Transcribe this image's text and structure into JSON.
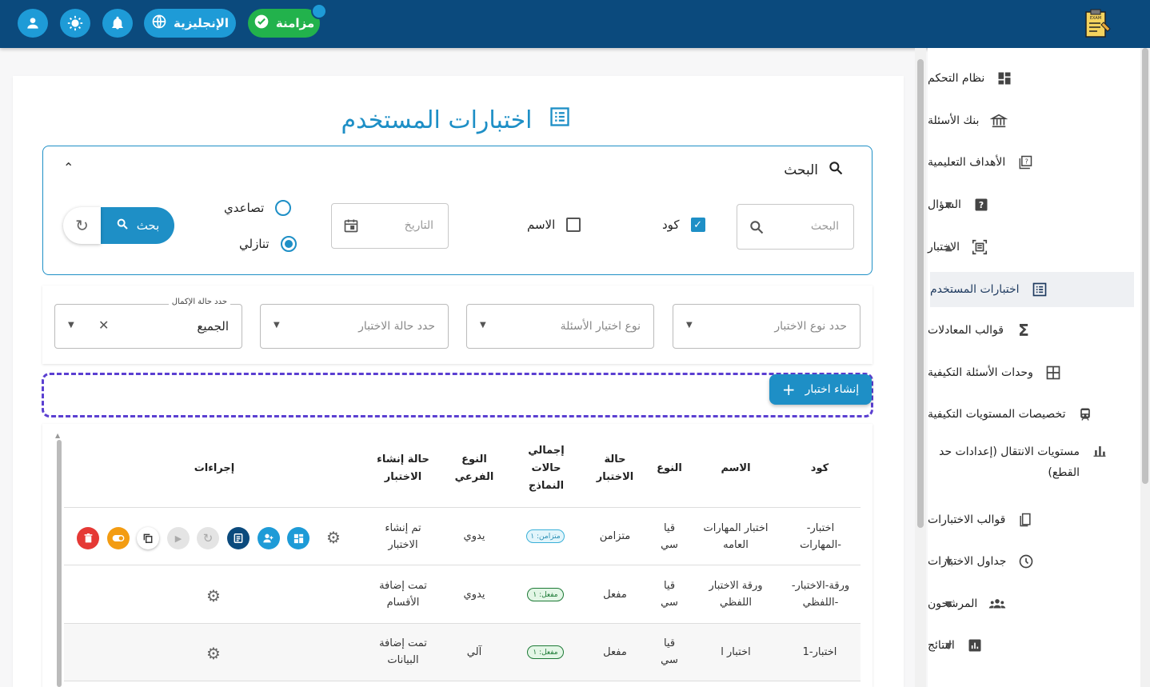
{
  "topbar": {
    "sync_label": "مزامنة",
    "language_label": "الإنجليزية",
    "icons": [
      "user-icon",
      "brightness-icon",
      "bell-icon",
      "globe-icon",
      "check-circle-icon"
    ],
    "colors": {
      "bar": "#0b4a7d",
      "button": "#1e9bd7",
      "sync": "#22b24c"
    }
  },
  "sidebar": {
    "items": [
      {
        "label": "نظام التحكم",
        "icon": "dashboard-icon"
      },
      {
        "label": "بنك الأسئلة",
        "icon": "bank-icon"
      },
      {
        "label": "الأهداف التعليمية",
        "icon": "quiz-icon"
      },
      {
        "label": "السؤال",
        "icon": "help-icon",
        "expandable": true
      },
      {
        "label": "الاختبار",
        "icon": "exam-icon",
        "expanded": true
      },
      {
        "label": "اختبارات المستخدم",
        "icon": "list-icon",
        "active": true
      },
      {
        "label": "قوالب المعادلات",
        "icon": "sigma-icon"
      },
      {
        "label": "وحدات الأسئلة التكيفية",
        "icon": "grid-icon"
      },
      {
        "label": "تخصيصات المستويات التكيفية",
        "icon": "train-icon"
      },
      {
        "label": "مستويات الانتقال (إعدادات حد القطع)",
        "icon": "bar-chart-icon"
      },
      {
        "label": "قوالب الاختبارات",
        "icon": "templates-icon"
      },
      {
        "label": "جداول الاختبارات",
        "icon": "clock-icon",
        "expandable": true
      },
      {
        "label": "المرشحون",
        "icon": "people-icon",
        "expandable": true
      },
      {
        "label": "النتائج",
        "icon": "results-icon",
        "expandable": true
      }
    ],
    "active_bg": "#eef0f3"
  },
  "page": {
    "title": "اختبارات المستخدم"
  },
  "search": {
    "title": "البحث",
    "input_placeholder": "البحث",
    "code_label": "كود",
    "code_checked": true,
    "name_label": "الاسم",
    "name_checked": false,
    "date_placeholder": "التاريخ",
    "ascending_label": "تصاعدي",
    "descending_label": "تنازلي",
    "sort": "descending",
    "search_button": "بحث"
  },
  "filters": {
    "exam_type_placeholder": "حدد نوع الاختبار",
    "question_selection_placeholder": "نوع اختيار الأسئلة",
    "exam_status_placeholder": "حدد حالة الاختبار",
    "completion_label": "حدد حالة الإكمال",
    "completion_value": "الجميع"
  },
  "create_button": "إنشاء اختبار",
  "table": {
    "headers": {
      "code": "كود",
      "name": "الاسم",
      "type": "النوع",
      "status": "حالة الاختبار",
      "totals": "إجمالي حالات النماذج",
      "subtype": "النوع الفرعي",
      "creation": "حالة إنشاء الاختبار",
      "actions": "إجراءات"
    },
    "rows": [
      {
        "code": "اختبار-المهارات-",
        "name": "اختبار المهارات العامه",
        "type": "قيا سي",
        "status": "متزامن",
        "chip": "متزامن: ١",
        "chip_kind": "sync",
        "subtype": "يدوي",
        "creation": "تم إنشاء الاختبار"
      },
      {
        "code": "ورقة-الاختبار-اللفظي-",
        "name": "ورقة الاختبار اللفظي",
        "type": "قيا سي",
        "status": "مفعل",
        "chip": "مفعل: ١",
        "chip_kind": "on",
        "subtype": "يدوي",
        "creation": "تمت إضافة الأقسام"
      },
      {
        "code": "اختبار-1",
        "name": "اختبار ا",
        "type": "قيا سي",
        "status": "مفعل",
        "chip": "مفعل: ١",
        "chip_kind": "on",
        "subtype": "آلي",
        "creation": "تمت إضافة البيانات"
      }
    ],
    "action_colors": {
      "delete": "#e53935",
      "toggle": "#f39c12",
      "primary": "#1e9bd7",
      "dark": "#0b4a7d"
    }
  }
}
